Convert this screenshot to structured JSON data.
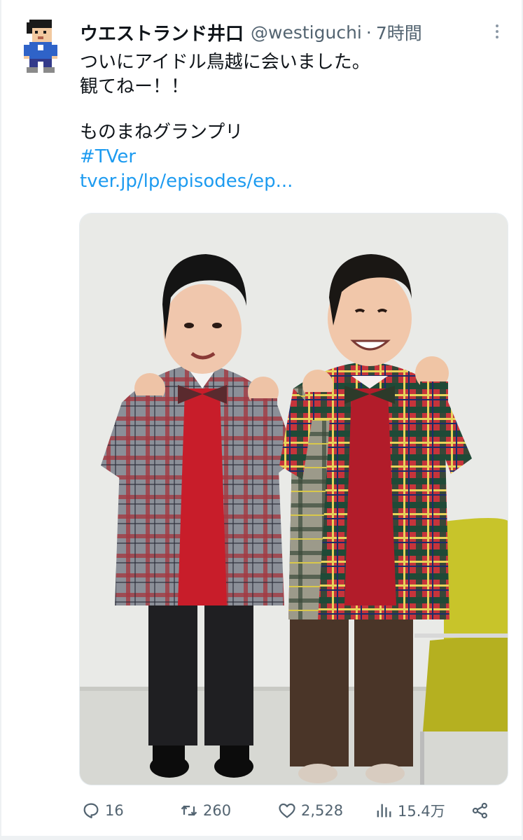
{
  "tweet": {
    "display_name": "ウエストランド井口",
    "handle": "@westiguchi",
    "separator": "·",
    "time": "7時間",
    "text_lines": [
      "ついにアイドル鳥越に会いました。",
      "観てねー！！"
    ],
    "show_name": "ものまねグランプリ",
    "hashtag": "#TVer",
    "url": "tver.jp/lp/episodes/ep..."
  },
  "actions": {
    "reply_count": "16",
    "retweet_count": "260",
    "like_count": "2,528",
    "view_count": "15.4万"
  },
  "icons": {
    "reply": "reply-icon",
    "retweet": "retweet-icon",
    "like": "heart-icon",
    "views": "views-icon",
    "share": "share-icon",
    "more": "more-icon"
  },
  "colors": {
    "text": "#0f1419",
    "secondary": "#536471",
    "link": "#1d9bf0"
  }
}
